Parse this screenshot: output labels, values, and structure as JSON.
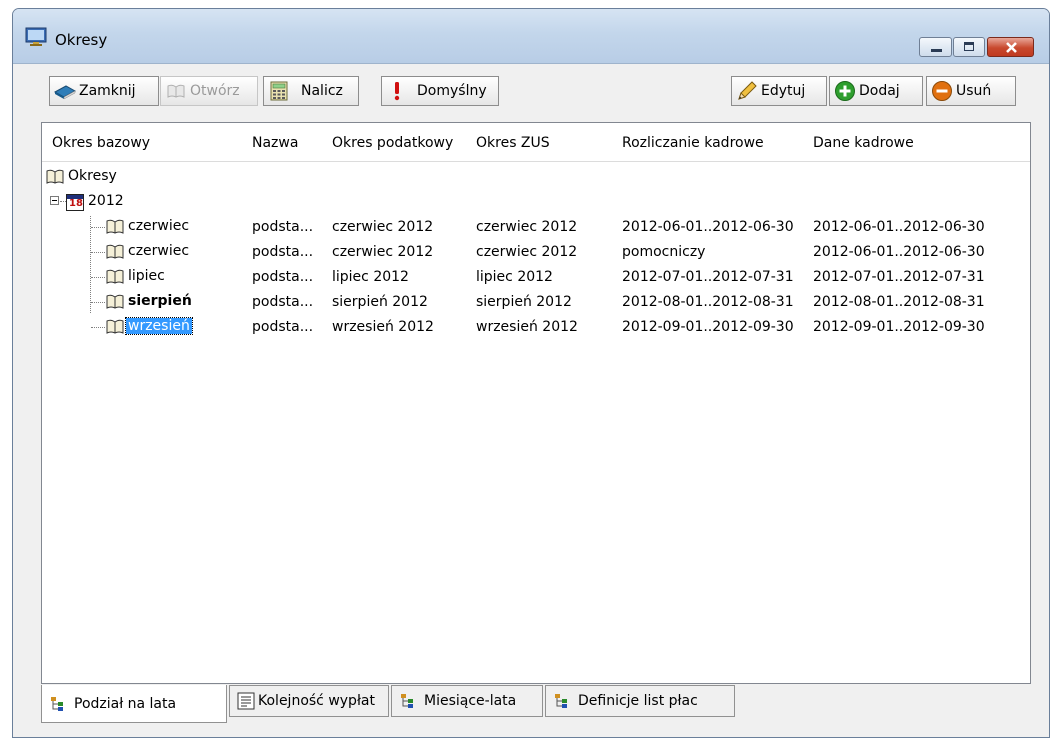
{
  "window": {
    "title": "Okresy"
  },
  "toolbar": {
    "close_label": "Zamknij",
    "open_label": "Otwórz",
    "calc_label": "Nalicz",
    "default_label": "Domyślny",
    "edit_label": "Edytuj",
    "add_label": "Dodaj",
    "remove_label": "Usuń"
  },
  "columns": [
    "Okres bazowy",
    "Nazwa",
    "Okres podatkowy",
    "Okres ZUS",
    "Rozliczanie kadrowe",
    "Dane kadrowe"
  ],
  "tree": {
    "root_label": "Okresy",
    "year_label": "2012",
    "year_icon_text": "18"
  },
  "rows": [
    {
      "base": "czerwiec",
      "name": "podsta...",
      "tax": "czerwiec 2012",
      "zus": "czerwiec 2012",
      "hr_settlement": "2012-06-01..2012-06-30",
      "hr_data": "2012-06-01..2012-06-30",
      "bold": false,
      "selected": false
    },
    {
      "base": "czerwiec",
      "name": "podsta...",
      "tax": "czerwiec 2012",
      "zus": "czerwiec 2012",
      "hr_settlement": "pomocniczy",
      "hr_data": "2012-06-01..2012-06-30",
      "bold": false,
      "selected": false
    },
    {
      "base": "lipiec",
      "name": "podsta...",
      "tax": "lipiec 2012",
      "zus": "lipiec 2012",
      "hr_settlement": "2012-07-01..2012-07-31",
      "hr_data": "2012-07-01..2012-07-31",
      "bold": false,
      "selected": false
    },
    {
      "base": "sierpień",
      "name": "podsta...",
      "tax": "sierpień 2012",
      "zus": "sierpień 2012",
      "hr_settlement": "2012-08-01..2012-08-31",
      "hr_data": "2012-08-01..2012-08-31",
      "bold": true,
      "selected": false
    },
    {
      "base": "wrzesień",
      "name": "podsta...",
      "tax": "wrzesień 2012",
      "zus": "wrzesień 2012",
      "hr_settlement": "2012-09-01..2012-09-30",
      "hr_data": "2012-09-01..2012-09-30",
      "bold": false,
      "selected": true
    }
  ],
  "tabs": [
    {
      "label": "Podział na lata",
      "active": true,
      "icon": "tree-icon"
    },
    {
      "label": "Kolejność wypłat",
      "active": false,
      "icon": "list-icon"
    },
    {
      "label": "Miesiące-lata",
      "active": false,
      "icon": "tree-icon"
    },
    {
      "label": "Definicje list płac",
      "active": false,
      "icon": "tree-icon"
    }
  ],
  "colors": {
    "selection": "#3399ff",
    "add_green": "#2e9e2e",
    "remove_orange": "#e07010",
    "default_red": "#d01010"
  }
}
